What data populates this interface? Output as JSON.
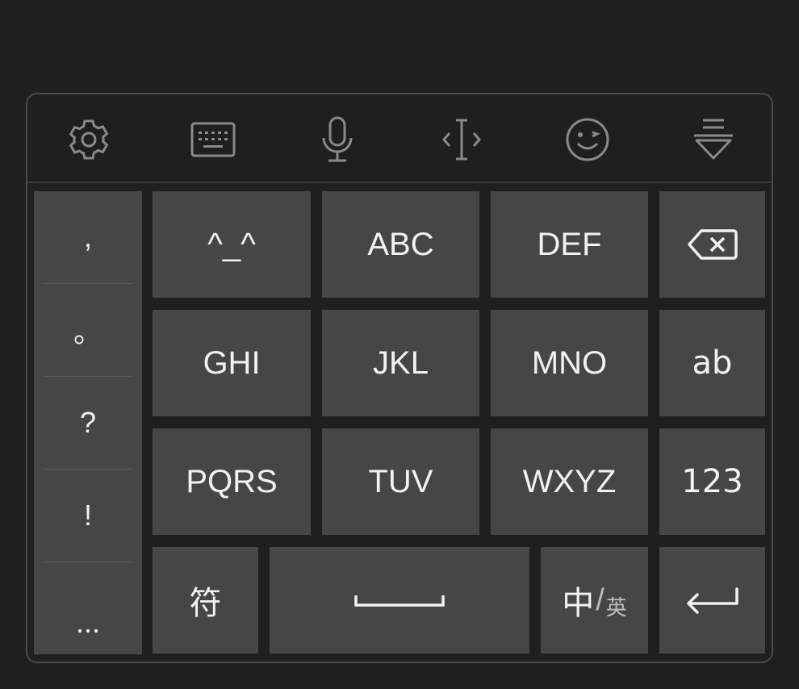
{
  "toolbar": {
    "icons": [
      "gear-icon",
      "keyboard-icon",
      "microphone-icon",
      "cursor-move-icon",
      "emoji-wink-icon",
      "hide-keyboard-icon"
    ]
  },
  "symbols": [
    ",",
    "。",
    "?",
    "!",
    "..."
  ],
  "keys": {
    "row1": [
      "^_^",
      "ABC",
      "DEF"
    ],
    "row2": [
      "GHI",
      "JKL",
      "MNO",
      "ab"
    ],
    "row3": [
      "PQRS",
      "TUV",
      "WXYZ",
      "123"
    ],
    "fu": "符",
    "lang_main": "中",
    "lang_slash": "/",
    "lang_sub": "英"
  },
  "colors": {
    "background": "#1f1f1f",
    "key": "#464646",
    "text": "#f2f2f2",
    "icon": "#8a8a8a"
  }
}
